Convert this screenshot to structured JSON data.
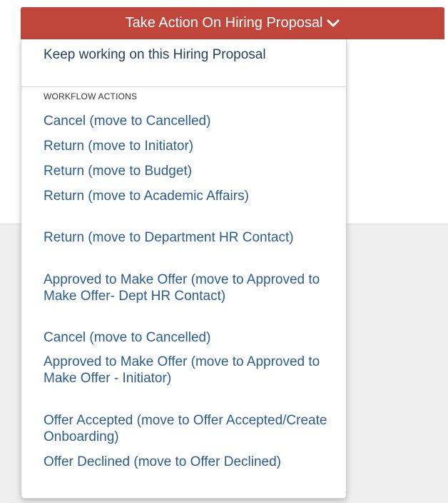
{
  "action_button": {
    "label": "Take Action On Hiring Proposal"
  },
  "menu": {
    "keep_working": "Keep working on this Hiring Proposal",
    "section_header": "WORKFLOW ACTIONS",
    "items": [
      "Cancel (move to Cancelled)",
      "Return (move to Initiator)",
      "Return (move to Budget)",
      "Return (move to Academic Affairs)",
      "Return (move to Department HR Contact)",
      "Approved to Make Offer (move to Approved to Make Offer- Dept HR Contact)",
      "Cancel (move to Cancelled)",
      "Approved to Make Offer (move to Approved to Make Offer - Initiator)",
      "Offer Accepted (move to Offer Accepted/Create Onboarding)",
      "Offer Declined (move to Offer Declined)"
    ]
  },
  "colors": {
    "button_bg": "#c0463b",
    "link": "#2a5d8f"
  }
}
